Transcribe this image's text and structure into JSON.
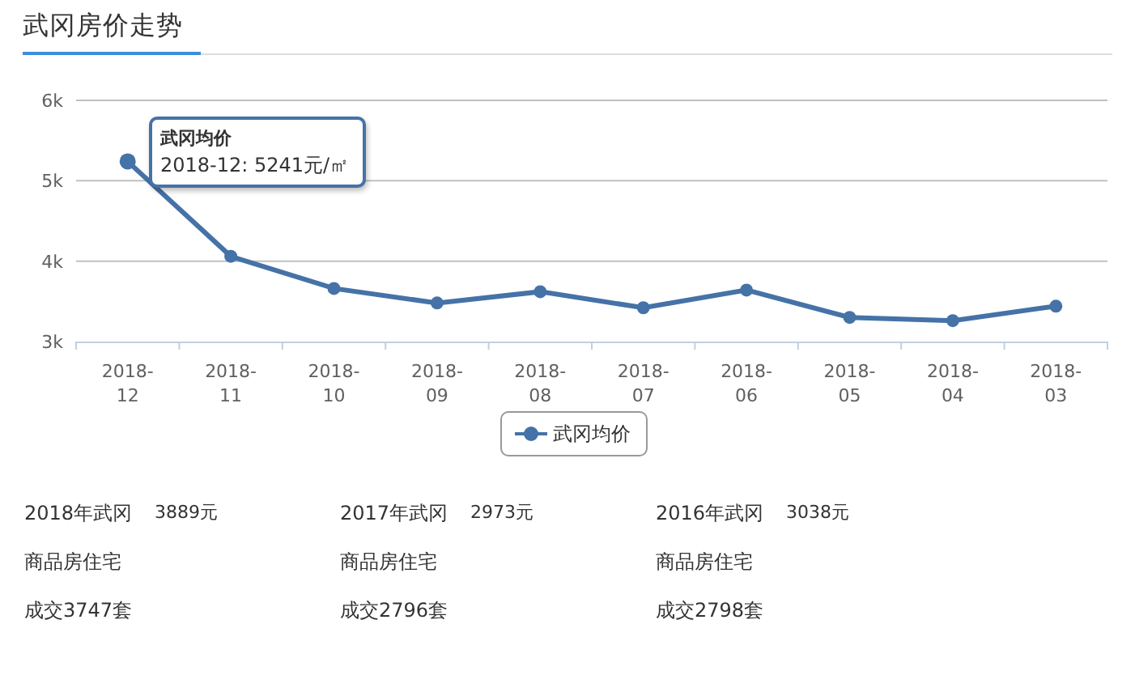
{
  "section_title": "武冈房价走势",
  "chart": {
    "chart_data": {
      "type": "line",
      "categories": [
        "2018-12",
        "2018-11",
        "2018-10",
        "2018-09",
        "2018-08",
        "2018-07",
        "2018-06",
        "2018-05",
        "2018-04",
        "2018-03"
      ],
      "series": [
        {
          "name": "武冈均价",
          "color": "#4572a7",
          "marker": "circle",
          "values": [
            5241,
            4060,
            3660,
            3480,
            3620,
            3420,
            3640,
            3300,
            3260,
            3440
          ]
        }
      ],
      "ylim": [
        3000,
        6000
      ],
      "yticks": [
        {
          "value": 3000,
          "label": "3k"
        },
        {
          "value": 4000,
          "label": "4k"
        },
        {
          "value": 5000,
          "label": "5k"
        },
        {
          "value": 6000,
          "label": "6k"
        }
      ]
    },
    "tooltip": {
      "series": "武冈均价",
      "text": "2018-12: 5241元/㎡"
    }
  },
  "stats": [
    {
      "year_label": "2018年武冈",
      "price": "3889元",
      "type": "商品房住宅",
      "deals": "成交3747套"
    },
    {
      "year_label": "2017年武冈",
      "price": "2973元",
      "type": "商品房住宅",
      "deals": "成交2796套"
    },
    {
      "year_label": "2016年武冈",
      "price": "3038元",
      "type": "商品房住宅",
      "deals": "成交2798套"
    }
  ]
}
